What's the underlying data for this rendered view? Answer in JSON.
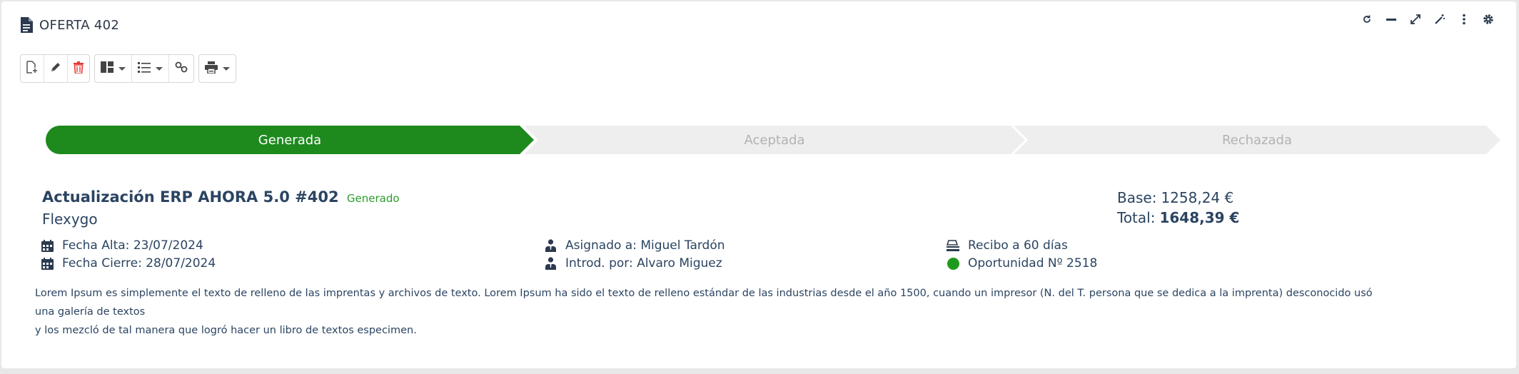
{
  "header": {
    "title": "OFERTA 402",
    "icon": "document-icon"
  },
  "window_tools": [
    "refresh-icon",
    "minimize-icon",
    "expand-icon",
    "magic-wand-icon",
    "more-vertical-icon",
    "settings-icon"
  ],
  "toolbar": {
    "groups": [
      [
        "new-document-icon",
        "edit-pencil-icon",
        "delete-trash-icon"
      ],
      [
        "layout-icon",
        "list-icon",
        "links-icon"
      ],
      [
        "print-icon"
      ]
    ],
    "colors": {
      "delete": "#e53935",
      "icon": "#555555"
    }
  },
  "stepper": {
    "steps": [
      "Generada",
      "Aceptada",
      "Rechazada"
    ],
    "active": "Generada",
    "active_color": "#1e8a1e",
    "inactive_color": "#eeeeee"
  },
  "offer": {
    "title": "Actualización ERP AHORA 5.0 #402",
    "status": "Generado",
    "company": "Flexygo",
    "base_label": "Base:",
    "base_value": "1258,24 €",
    "total_label": "Total:",
    "total_value": "1648,39 €"
  },
  "details": {
    "fecha_alta": "Fecha Alta: 23/07/2024",
    "fecha_cierre": "Fecha Cierre: 28/07/2024",
    "asignado": "Asignado a: Miguel Tardón",
    "introducido": "Introd. por: Alvaro Miguez",
    "recibo": "Recibo a 60 días",
    "oportunidad": "Oportunidad Nº 2518",
    "oportunidad_color": "#1e9a1e"
  },
  "description_line1": "Lorem Ipsum es simplemente el texto de relleno de las imprentas y archivos de texto. Lorem Ipsum ha sido el texto de relleno estándar de las industrias desde el año 1500, cuando un impresor (N. del T. persona que se dedica a la imprenta) desconocido usó una galería de textos",
  "description_line2": "y los mezcló de tal manera que logró hacer un libro de textos especimen."
}
